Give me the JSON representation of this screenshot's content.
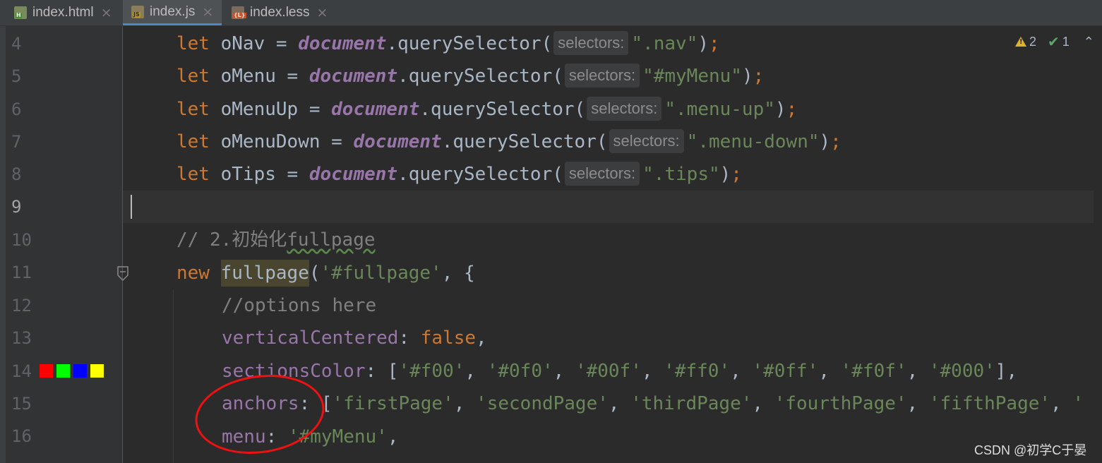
{
  "tabs": [
    {
      "label": "index.html",
      "icon": "html-file-icon",
      "active": false
    },
    {
      "label": "index.js",
      "icon": "js-file-icon",
      "active": true
    },
    {
      "label": "index.less",
      "icon": "less-file-icon",
      "active": false
    }
  ],
  "tab_close_glyph": "×",
  "inspection": {
    "warnings": "2",
    "weak_warnings": "1"
  },
  "line_numbers": [
    "4",
    "5",
    "6",
    "7",
    "8",
    "9",
    "10",
    "11",
    "12",
    "13",
    "14",
    "15",
    "16"
  ],
  "current_line": "9",
  "param_hint": "selectors:",
  "lines": {
    "l4": {
      "kw": "let",
      "name": " oNav = ",
      "obj": "document",
      "method": ".querySelector(",
      "arg": "\".nav\"",
      "close": ")",
      "semi": ";"
    },
    "l5": {
      "kw": "let",
      "name": " oMenu = ",
      "obj": "document",
      "method": ".querySelector(",
      "arg": "\"#myMenu\"",
      "close": ")",
      "semi": ";"
    },
    "l6": {
      "kw": "let",
      "name": " oMenuUp = ",
      "obj": "document",
      "method": ".querySelector(",
      "arg": "\".menu-up\"",
      "close": ")",
      "semi": ";"
    },
    "l7": {
      "kw": "let",
      "name": " oMenuDown = ",
      "obj": "document",
      "method": ".querySelector(",
      "arg": "\".menu-down\"",
      "close": ")",
      "semi": ";"
    },
    "l8": {
      "kw": "let",
      "name": " oTips = ",
      "obj": "document",
      "method": ".querySelector(",
      "arg": "\".tips\"",
      "close": ")",
      "semi": ";"
    },
    "l10": {
      "comment_prefix": "// 2.初始化",
      "comment_word": "fullpage"
    },
    "l11": {
      "kw": "new",
      "fn": "fullpage",
      "open": "(",
      "arg": "'#fullpage'",
      "rest": ", {"
    },
    "l12": {
      "comment": "//options here"
    },
    "l13": {
      "prop": "verticalCentered",
      "colon": ": ",
      "value": "false",
      "comma": ","
    },
    "l14": {
      "prop": "sectionsColor",
      "colon": ": [",
      "items": [
        "'#f00'",
        "'#0f0'",
        "'#00f'",
        "'#ff0'",
        "'#0ff'",
        "'#f0f'",
        "'#000'"
      ],
      "sep": ", ",
      "end": "],"
    },
    "l15": {
      "prop": "anchors",
      "colon": ": [",
      "items": [
        "'firstPage'",
        "'secondPage'",
        "'thirdPage'",
        "'fourthPage'",
        "'fifthPage'",
        "'"
      ],
      "sep": ", "
    },
    "l16": {
      "prop": "menu",
      "colon": ": ",
      "value": "'#myMenu'",
      "comma": ","
    }
  },
  "color_swatches": [
    "#ff0000",
    "#00ff00",
    "#0000ff",
    "#ffff00"
  ],
  "watermark": "CSDN @初学C于晏"
}
